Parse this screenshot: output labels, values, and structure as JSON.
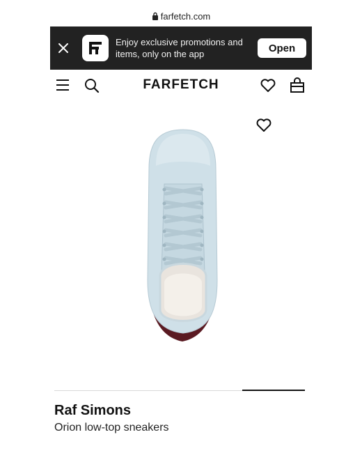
{
  "browser": {
    "url": "farfetch.com"
  },
  "app_banner": {
    "message": "Enjoy exclusive promotions and items, only on the app",
    "open_label": "Open"
  },
  "header": {
    "brand_logo": "FARFETCH"
  },
  "icons": {
    "lock": "lock-icon",
    "close": "close-icon",
    "app_logo": "farfetch-app-logo",
    "menu": "hamburger-menu-icon",
    "search": "search-icon",
    "wishlist": "heart-icon",
    "bag": "shopping-bag-icon"
  },
  "gallery": {
    "slide_count": 4,
    "active_slide": 4
  },
  "product": {
    "brand": "Raf Simons",
    "name": "Orion low-top sneakers",
    "image_alt": "Light blue leather low-top sneaker with burgundy sole"
  },
  "colors": {
    "banner_bg": "#222222",
    "sneaker_upper": "#cfe0e8",
    "sneaker_sole": "#5a1a22"
  }
}
